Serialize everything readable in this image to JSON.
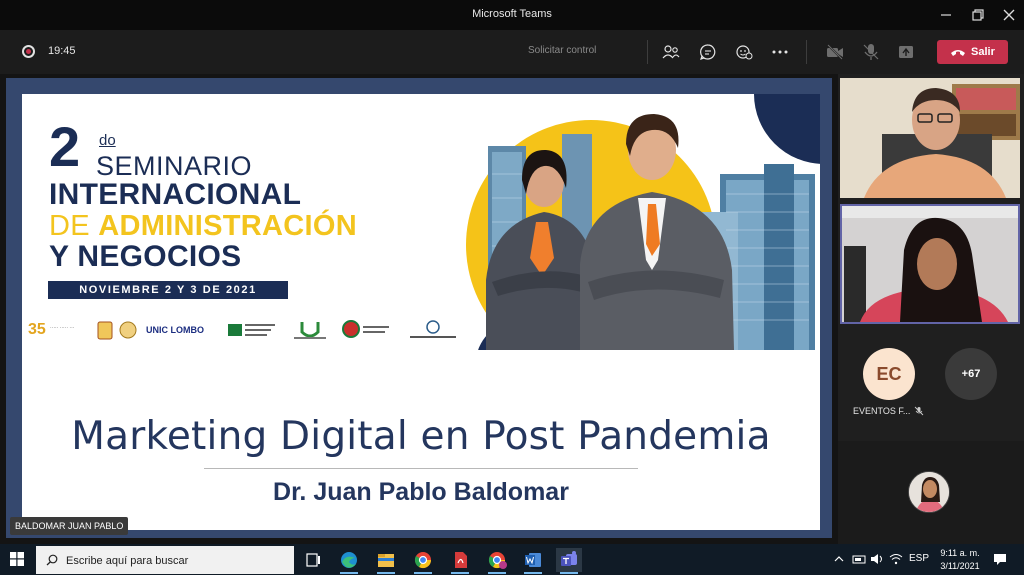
{
  "window": {
    "title": "Microsoft Teams",
    "minimize_icon": "minimize-icon",
    "maximize_icon": "restore-icon",
    "close_icon": "close-icon"
  },
  "toolbar": {
    "recording_icon": "recording-icon",
    "elapsed": "19:45",
    "request_control": "Solicitar control",
    "icons": [
      "people-icon",
      "chat-icon",
      "reactions-icon",
      "more-options-icon",
      "camera-off-icon",
      "mic-icon",
      "share-tray-icon"
    ],
    "leave_label": "Salir",
    "leave_color": "#c4314b"
  },
  "slide": {
    "edition_number": "2",
    "edition_suffix": "do",
    "line1": "SEMINARIO",
    "line2": "INTERNACIONAL",
    "line3_lead": "DE ",
    "line3_rest": "ADMINISTRACIÓN",
    "line4": "Y NEGOCIOS",
    "dates": "NOVIEMBRE 2 Y 3 DE 2021",
    "logos": [
      "35",
      "UNIC LOMBO"
    ],
    "talk_title": "Marketing Digital en Post Pandemia",
    "speaker": "Dr. Juan Pablo Baldomar",
    "colors": {
      "navy": "#1b2d55",
      "gold": "#f3c41e"
    }
  },
  "presenter_tag": "BALDOMAR JUAN PABLO",
  "participants": {
    "ec_initials": "EC",
    "ec_name": "EVENTOS F...",
    "more_count": "+67",
    "mute_icon": "mic-off-icon"
  },
  "taskbar": {
    "search_placeholder": "Escribe aquí para buscar",
    "apps": [
      "task-view-icon",
      "edge-icon",
      "file-explorer-icon",
      "chrome-icon",
      "pdf-reader-icon",
      "chrome-profile-icon",
      "word-icon",
      "teams-icon",
      "blank-app-icon"
    ],
    "language": "ESP",
    "time": "9:11 a. m.",
    "date": "3/11/2021"
  }
}
